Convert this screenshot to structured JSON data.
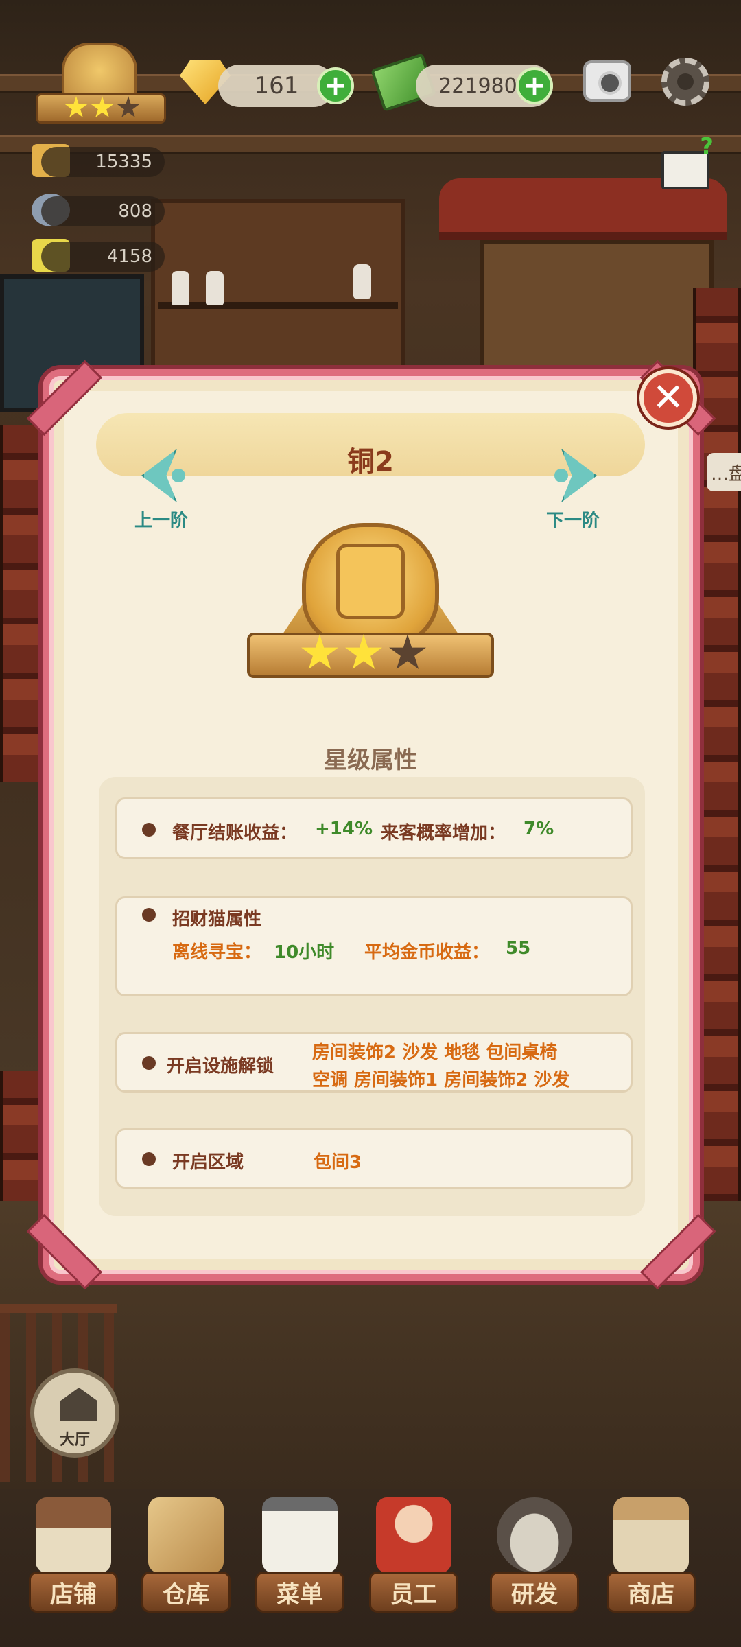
{
  "hud": {
    "gems": "161",
    "coins": "2219802",
    "badge_stars": 2,
    "stats": [
      "15335",
      "808",
      "4158"
    ]
  },
  "side_tab": "…盘",
  "dialog": {
    "title": "铜2",
    "prev_label": "上一阶",
    "next_label": "下一阶",
    "emblem_stars": 2,
    "emblem_stars_max": 3,
    "section_title": "星级属性",
    "rows": {
      "checkout": {
        "label": "餐厅结账收益：",
        "value": "+14%",
        "label2": "来客概率增加：",
        "value2": "7%"
      },
      "lucky_cat": {
        "title": "招财猫属性",
        "label": "离线寻宝：",
        "value": "10小时",
        "label2": "平均金币收益：",
        "value2": "55"
      },
      "facilities": {
        "title": "开启设施解锁",
        "line1": "房间装饰2  沙发  地毯  包间桌椅",
        "line2": "空调  房间装饰1  房间装饰2  沙发"
      },
      "area": {
        "title": "开启区域",
        "value": "包间3"
      }
    }
  },
  "hall_button": "大厅",
  "bottom_nav": [
    "店铺",
    "仓库",
    "菜单",
    "员工",
    "研发",
    "商店"
  ],
  "colors": {
    "dialog_border": "#de6d7e",
    "title": "#8a3b1c",
    "teal": "#2b8a84",
    "green_value": "#3f8a2a",
    "orange_value": "#d76a12"
  }
}
